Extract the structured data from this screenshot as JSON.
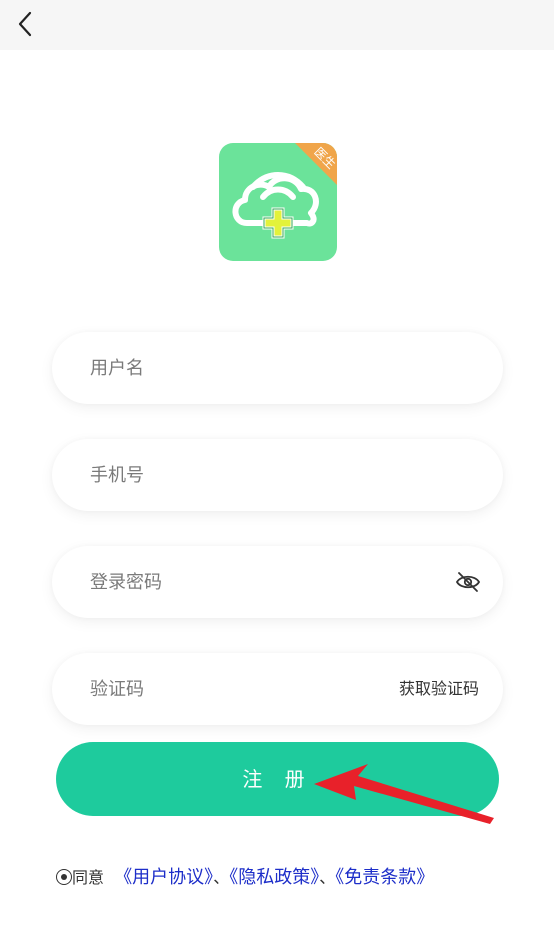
{
  "topbar": {
    "back_icon": "chevron-left-icon"
  },
  "logo": {
    "badge_text": "医生",
    "colors": {
      "background": "#6be39a",
      "badge": "#f0a54a",
      "cross": "#e3f23a"
    }
  },
  "form": {
    "username_placeholder": "用户名",
    "phone_placeholder": "手机号",
    "password_placeholder": "登录密码",
    "code_placeholder": "验证码",
    "get_code_label": "获取验证码",
    "password_toggle_icon": "eye-off-icon"
  },
  "submit": {
    "label": "注 册",
    "color": "#1ecb9d"
  },
  "agreement": {
    "prefix": "同意",
    "links": [
      "《用户协议》",
      "《隐私政策》",
      "《免责条款》"
    ],
    "separator": "、",
    "link_color": "#1d2ec9"
  },
  "annotation": {
    "arrow_color": "#e8212a"
  }
}
